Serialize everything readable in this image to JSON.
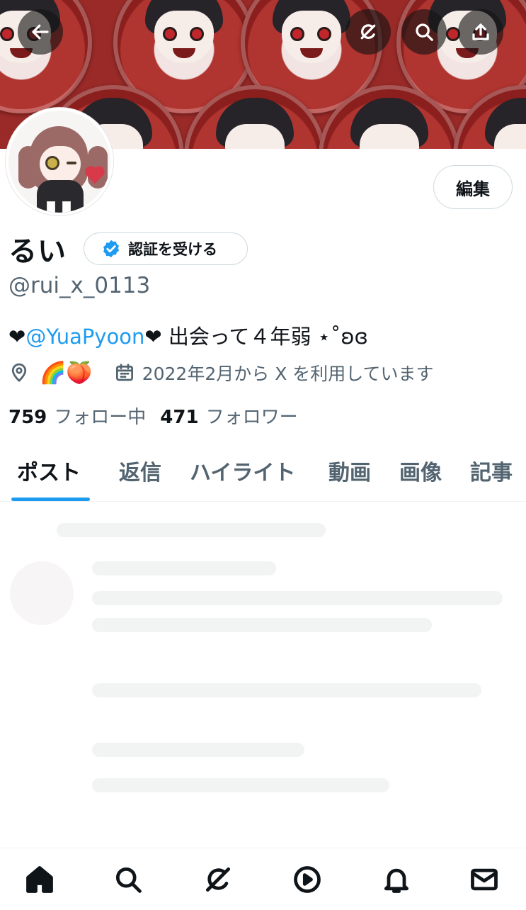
{
  "profile": {
    "name": "るい",
    "handle": "@rui_x_0113",
    "verify_label": "認証を受ける",
    "edit_label": "編集",
    "bio": {
      "heart_start": "❤",
      "mention": "@YuaPyoon",
      "rest": "❤ 出会って４年弱 ⋆˚ʚɞ"
    },
    "location": "🌈🍑",
    "joined": "2022年2月から X を利用しています",
    "following_count": "759",
    "following_label": "フォロー中",
    "followers_count": "471",
    "followers_label": "フォロワー"
  },
  "tabs": [
    {
      "label": "ポスト",
      "active": true
    },
    {
      "label": "返信",
      "active": false
    },
    {
      "label": "ハイライト",
      "active": false
    },
    {
      "label": "動画",
      "active": false
    },
    {
      "label": "画像",
      "active": false
    },
    {
      "label": "記事",
      "active": false
    }
  ],
  "icons": {
    "top": [
      "back-arrow-icon",
      "grok-icon",
      "search-icon",
      "share-icon"
    ],
    "meta": [
      "location-icon",
      "calendar-icon"
    ],
    "bottom": [
      "home-icon",
      "search-icon",
      "grok-icon",
      "video-icon",
      "notifications-icon",
      "messages-icon"
    ]
  },
  "colors": {
    "accent": "#1d9bf0",
    "secondary_text": "#536471",
    "primary_text": "#0f1419"
  }
}
